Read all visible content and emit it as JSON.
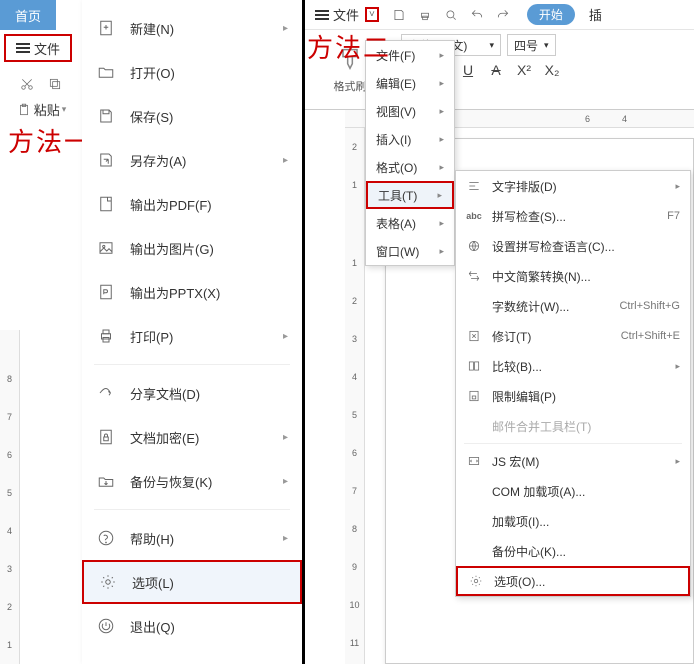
{
  "left": {
    "home_tab": "首页",
    "file_btn": "文件",
    "annotation": "方法一",
    "paste_label": "粘贴",
    "menu": [
      {
        "label": "新建(N)",
        "sub": true
      },
      {
        "label": "打开(O)"
      },
      {
        "label": "保存(S)"
      },
      {
        "label": "另存为(A)",
        "sub": true
      },
      {
        "label": "输出为PDF(F)"
      },
      {
        "label": "输出为图片(G)"
      },
      {
        "label": "输出为PPTX(X)"
      },
      {
        "label": "打印(P)",
        "sub": true
      },
      {
        "sep": true
      },
      {
        "label": "分享文档(D)"
      },
      {
        "label": "文档加密(E)",
        "sub": true
      },
      {
        "label": "备份与恢复(K)",
        "sub": true
      },
      {
        "sep": true
      },
      {
        "label": "帮助(H)",
        "sub": true
      },
      {
        "label": "选项(L)",
        "highlight": true
      },
      {
        "label": "退出(Q)"
      }
    ],
    "ruler_v": [
      "1",
      "2",
      "3",
      "4",
      "5",
      "6",
      "7",
      "8"
    ]
  },
  "right": {
    "file_btn": "文件",
    "start_pill": "开始",
    "insert": "插",
    "annotation": "方法二",
    "format_brush": "格式刷",
    "font_name": "宋体 (正文)",
    "font_size": "四号",
    "ruler_h": [
      "6",
      "4"
    ],
    "ruler_v": [
      "2",
      "1",
      "1",
      "2",
      "3",
      "4",
      "5",
      "6",
      "7",
      "8",
      "9",
      "10",
      "11"
    ],
    "submenu1": [
      {
        "label": "文件(F)",
        "sub": true
      },
      {
        "label": "编辑(E)",
        "sub": true
      },
      {
        "label": "视图(V)",
        "sub": true
      },
      {
        "label": "插入(I)",
        "sub": true
      },
      {
        "label": "格式(O)",
        "sub": true
      },
      {
        "label": "工具(T)",
        "sub": true,
        "sel": true,
        "highlight": true
      },
      {
        "label": "表格(A)",
        "sub": true
      },
      {
        "label": "窗口(W)",
        "sub": true
      }
    ],
    "submenu2": [
      {
        "label": "文字排版(D)",
        "sub": true
      },
      {
        "label": "拼写检查(S)...",
        "short": "F7"
      },
      {
        "label": "设置拼写检查语言(C)..."
      },
      {
        "label": "中文简繁转换(N)..."
      },
      {
        "label": "字数统计(W)...",
        "short": "Ctrl+Shift+G"
      },
      {
        "label": "修订(T)",
        "short": "Ctrl+Shift+E"
      },
      {
        "label": "比较(B)...",
        "sub": true
      },
      {
        "label": "限制编辑(P)"
      },
      {
        "label": "邮件合并工具栏(T)",
        "disabled": true
      },
      {
        "sep": true
      },
      {
        "label": "JS 宏(M)",
        "sub": true
      },
      {
        "label": "COM 加载项(A)..."
      },
      {
        "label": "加载项(I)..."
      },
      {
        "label": "备份中心(K)..."
      },
      {
        "label": "选项(O)...",
        "highlight": true
      }
    ]
  }
}
